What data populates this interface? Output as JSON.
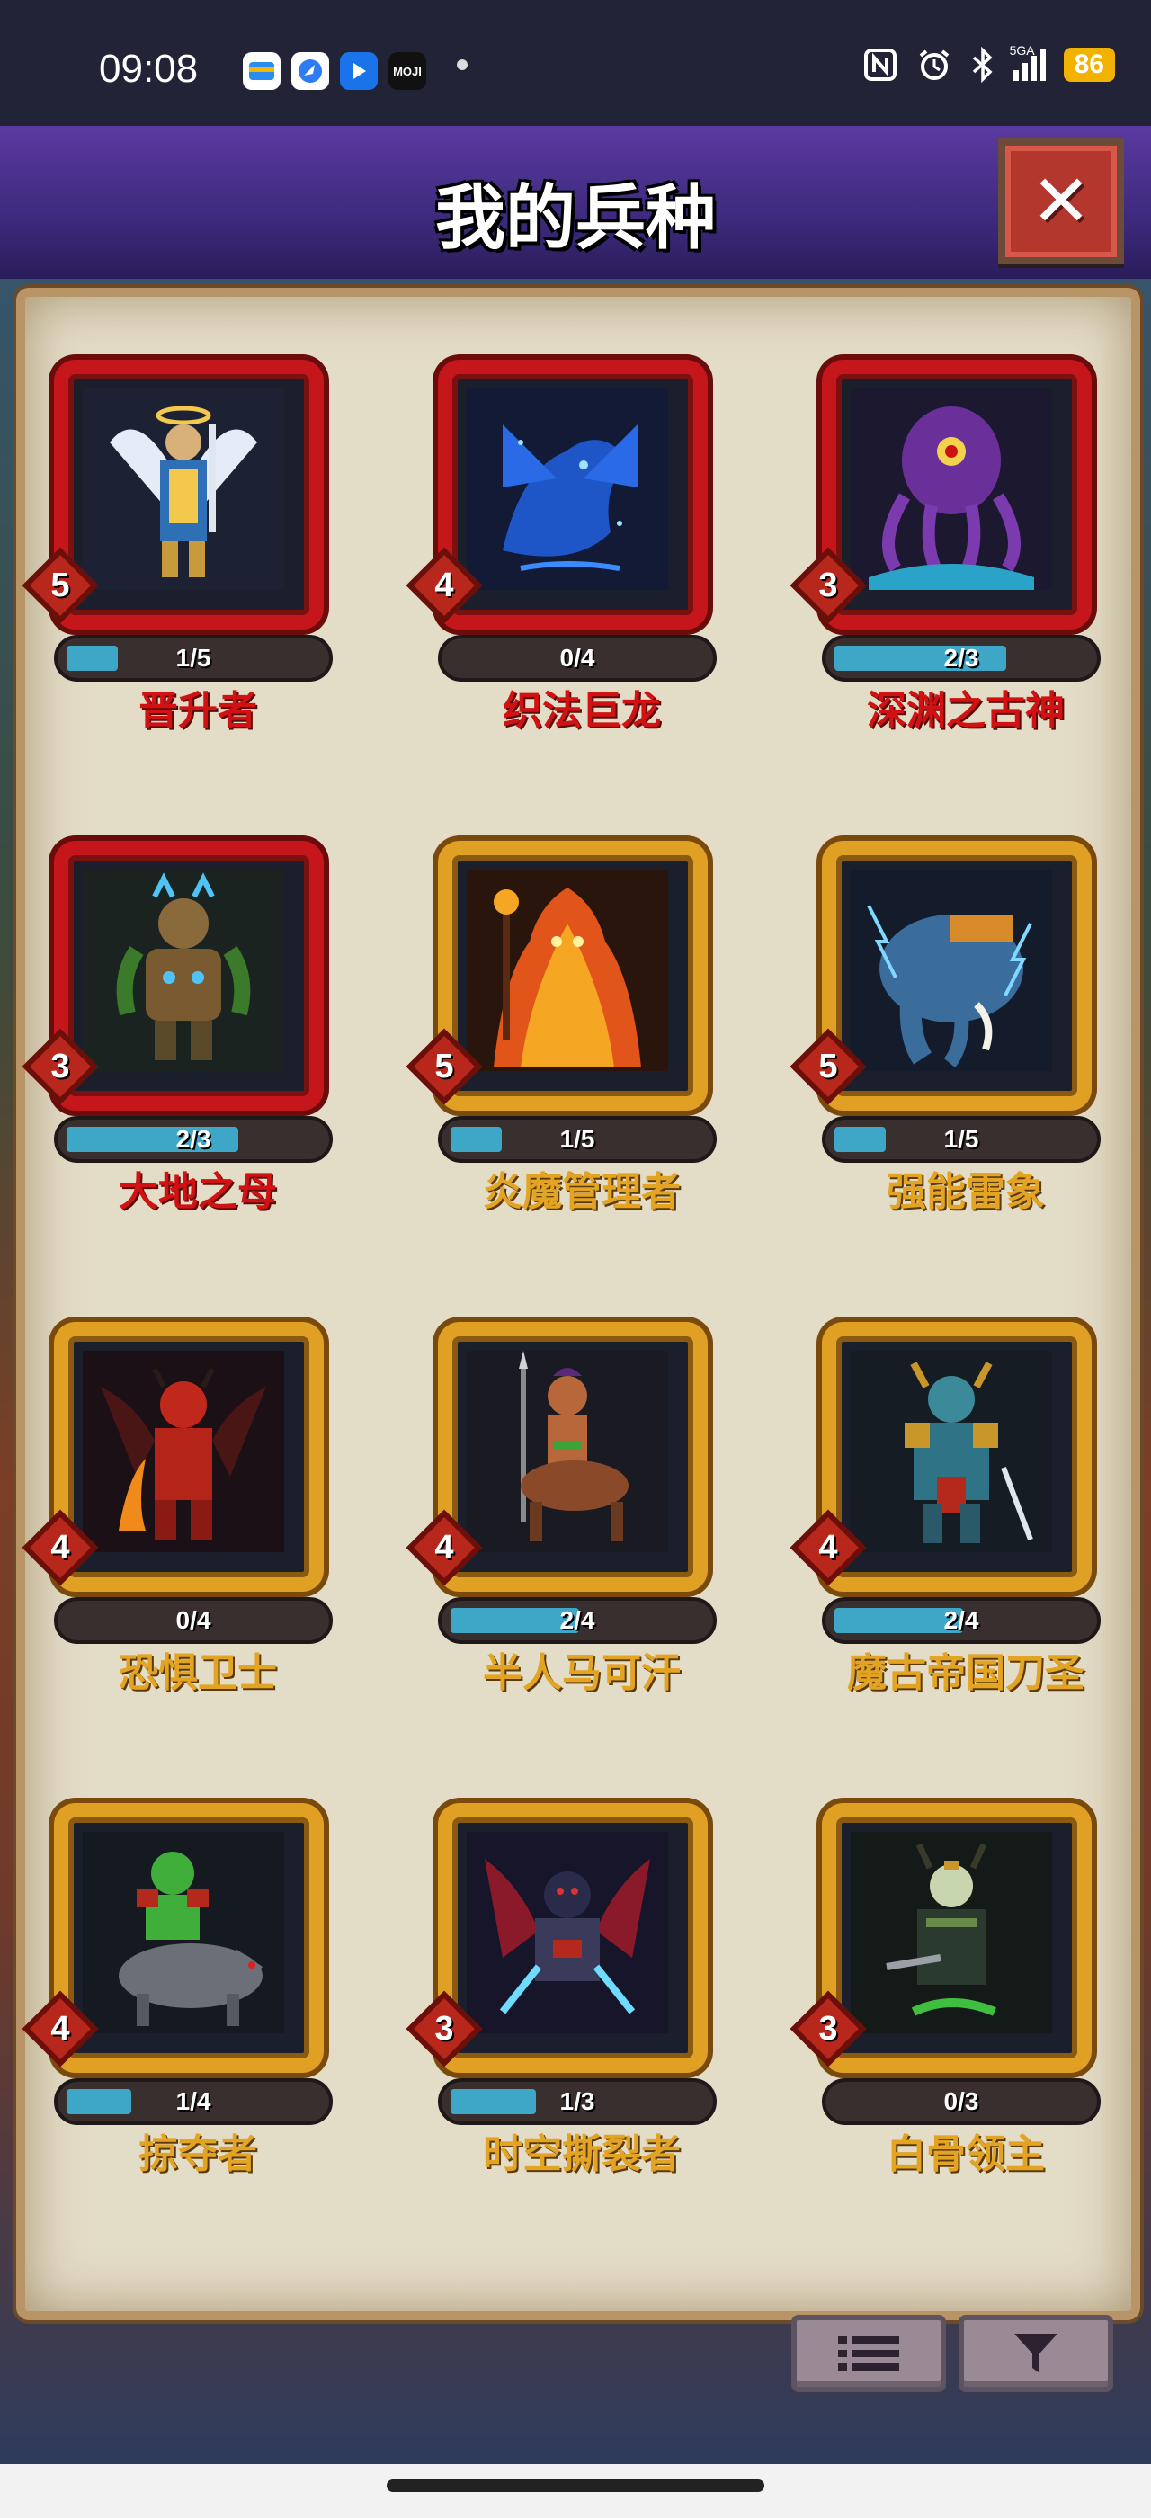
{
  "status_bar": {
    "time": "09:08",
    "app_icons": [
      "wallet-icon",
      "browser-icon",
      "video-icon",
      "moji-weather-icon"
    ],
    "moji_label": "MOJI",
    "system_icons": [
      "nfc-icon",
      "alarm-icon",
      "bluetooth-icon",
      "5g-signal-icon"
    ],
    "signal_label": "5GA",
    "battery": "86"
  },
  "header": {
    "title": "我的兵种",
    "close_icon": "close-icon"
  },
  "units": [
    {
      "name": "晋升者",
      "level": "5",
      "progress": "1/5",
      "progress_fraction": 0.2,
      "rarity": "red",
      "portrait": "winged-angel-portrait"
    },
    {
      "name": "织法巨龙",
      "level": "4",
      "progress": "0/4",
      "progress_fraction": 0.0,
      "rarity": "red",
      "portrait": "blue-dragon-portrait"
    },
    {
      "name": "深渊之古神",
      "level": "3",
      "progress": "2/3",
      "progress_fraction": 0.667,
      "rarity": "red",
      "portrait": "tentacle-eye-portrait"
    },
    {
      "name": "大地之母",
      "level": "3",
      "progress": "2/3",
      "progress_fraction": 0.667,
      "rarity": "red",
      "portrait": "earth-mother-portrait"
    },
    {
      "name": "炎魔管理者",
      "level": "5",
      "progress": "1/5",
      "progress_fraction": 0.2,
      "rarity": "orange",
      "portrait": "flame-demon-portrait"
    },
    {
      "name": "强能雷象",
      "level": "5",
      "progress": "1/5",
      "progress_fraction": 0.2,
      "rarity": "orange",
      "portrait": "thunder-elephant-portrait"
    },
    {
      "name": "恐惧卫士",
      "level": "4",
      "progress": "0/4",
      "progress_fraction": 0.0,
      "rarity": "orange",
      "portrait": "red-demon-portrait"
    },
    {
      "name": "半人马可汗",
      "level": "4",
      "progress": "2/4",
      "progress_fraction": 0.5,
      "rarity": "orange",
      "portrait": "centaur-khan-portrait"
    },
    {
      "name": "魔古帝国刀圣",
      "level": "4",
      "progress": "2/4",
      "progress_fraction": 0.5,
      "rarity": "orange",
      "portrait": "mogu-bladesman-portrait"
    },
    {
      "name": "掠夺者",
      "level": "4",
      "progress": "1/4",
      "progress_fraction": 0.25,
      "rarity": "orange",
      "portrait": "orc-wolf-rider-portrait"
    },
    {
      "name": "时空撕裂者",
      "level": "3",
      "progress": "1/3",
      "progress_fraction": 0.333,
      "rarity": "orange",
      "portrait": "time-rift-dragon-portrait"
    },
    {
      "name": "白骨领主",
      "level": "3",
      "progress": "0/3",
      "progress_fraction": 0.0,
      "rarity": "orange",
      "portrait": "bone-lord-portrait"
    }
  ],
  "toolbar": {
    "list_icon": "list-icon",
    "filter_icon": "filter-icon"
  },
  "colors": {
    "rarity_red": "#c5161b",
    "rarity_orange": "#e0a024",
    "progress_fill": "#3ea6c7",
    "header_purple": "#4a3290"
  }
}
